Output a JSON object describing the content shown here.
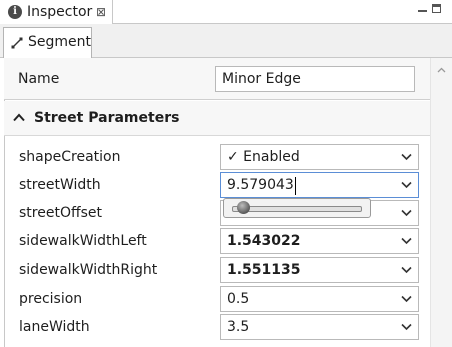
{
  "view": {
    "title": "Inspector",
    "close_glyph": "⊠",
    "icon": "info-icon",
    "info_glyph": "i"
  },
  "tabs": [
    {
      "label": "Segment",
      "icon": "segment-icon"
    }
  ],
  "object": {
    "name_label": "Name",
    "name_value": "Minor Edge"
  },
  "section": {
    "title": "Street Parameters",
    "expanded": true
  },
  "params": [
    {
      "label": "shapeCreation",
      "value": "✓ Enabled",
      "bold": false
    },
    {
      "label": "streetWidth",
      "value": "9.579043",
      "bold": false,
      "editing": true
    },
    {
      "label": "streetOffset",
      "value": "0",
      "bold": false
    },
    {
      "label": "sidewalkWidthLeft",
      "value": "1.543022",
      "bold": true
    },
    {
      "label": "sidewalkWidthRight",
      "value": "1.551135",
      "bold": true
    },
    {
      "label": "precision",
      "value": "0.5",
      "bold": false
    },
    {
      "label": "laneWidth",
      "value": "3.5",
      "bold": false
    }
  ],
  "slider": {
    "level": 0.04
  },
  "colors": {
    "focus_border": "#5b8ed6",
    "field_border": "#b9b9b9",
    "panel_bg": "#f7f7f7"
  }
}
